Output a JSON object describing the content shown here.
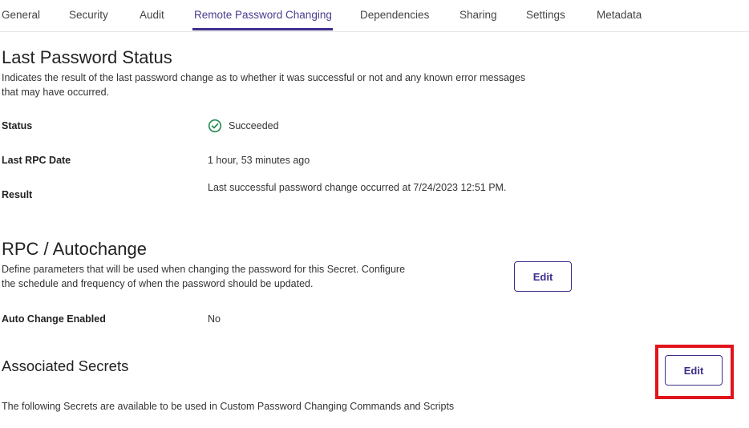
{
  "tabs": [
    {
      "label": "General"
    },
    {
      "label": "Security"
    },
    {
      "label": "Audit"
    },
    {
      "label": "Remote Password Changing",
      "active": true
    },
    {
      "label": "Dependencies"
    },
    {
      "label": "Sharing"
    },
    {
      "label": "Settings"
    },
    {
      "label": "Metadata"
    }
  ],
  "last_password_status": {
    "title": "Last Password Status",
    "description_line1": "Indicates the result of the last password change as to whether it was successful or not and any known error messages",
    "description_line2": "that may have occurred.",
    "status_label": "Status",
    "status_value": "Succeeded",
    "status_icon": "check-circle-icon",
    "last_rpc_label": "Last RPC Date",
    "last_rpc_value": "1 hour, 53 minutes ago",
    "result_label": "Result",
    "result_value": "Last successful password change occurred at 7/24/2023 12:51 PM."
  },
  "rpc_autochange": {
    "title": "RPC / Autochange",
    "description_line1": "Define parameters that will be used when changing the password for this Secret. Configure",
    "description_line2": "the schedule and frequency of when the password should be updated.",
    "edit_label": "Edit",
    "auto_change_label": "Auto Change Enabled",
    "auto_change_value": "No"
  },
  "associated_secrets": {
    "title": "Associated Secrets",
    "edit_label": "Edit",
    "description": "The following Secrets are available to be used in Custom Password Changing Commands and Scripts"
  },
  "colors": {
    "accent": "#3d2e8c",
    "success": "#1f8a4c",
    "highlight": "#e1141d"
  }
}
